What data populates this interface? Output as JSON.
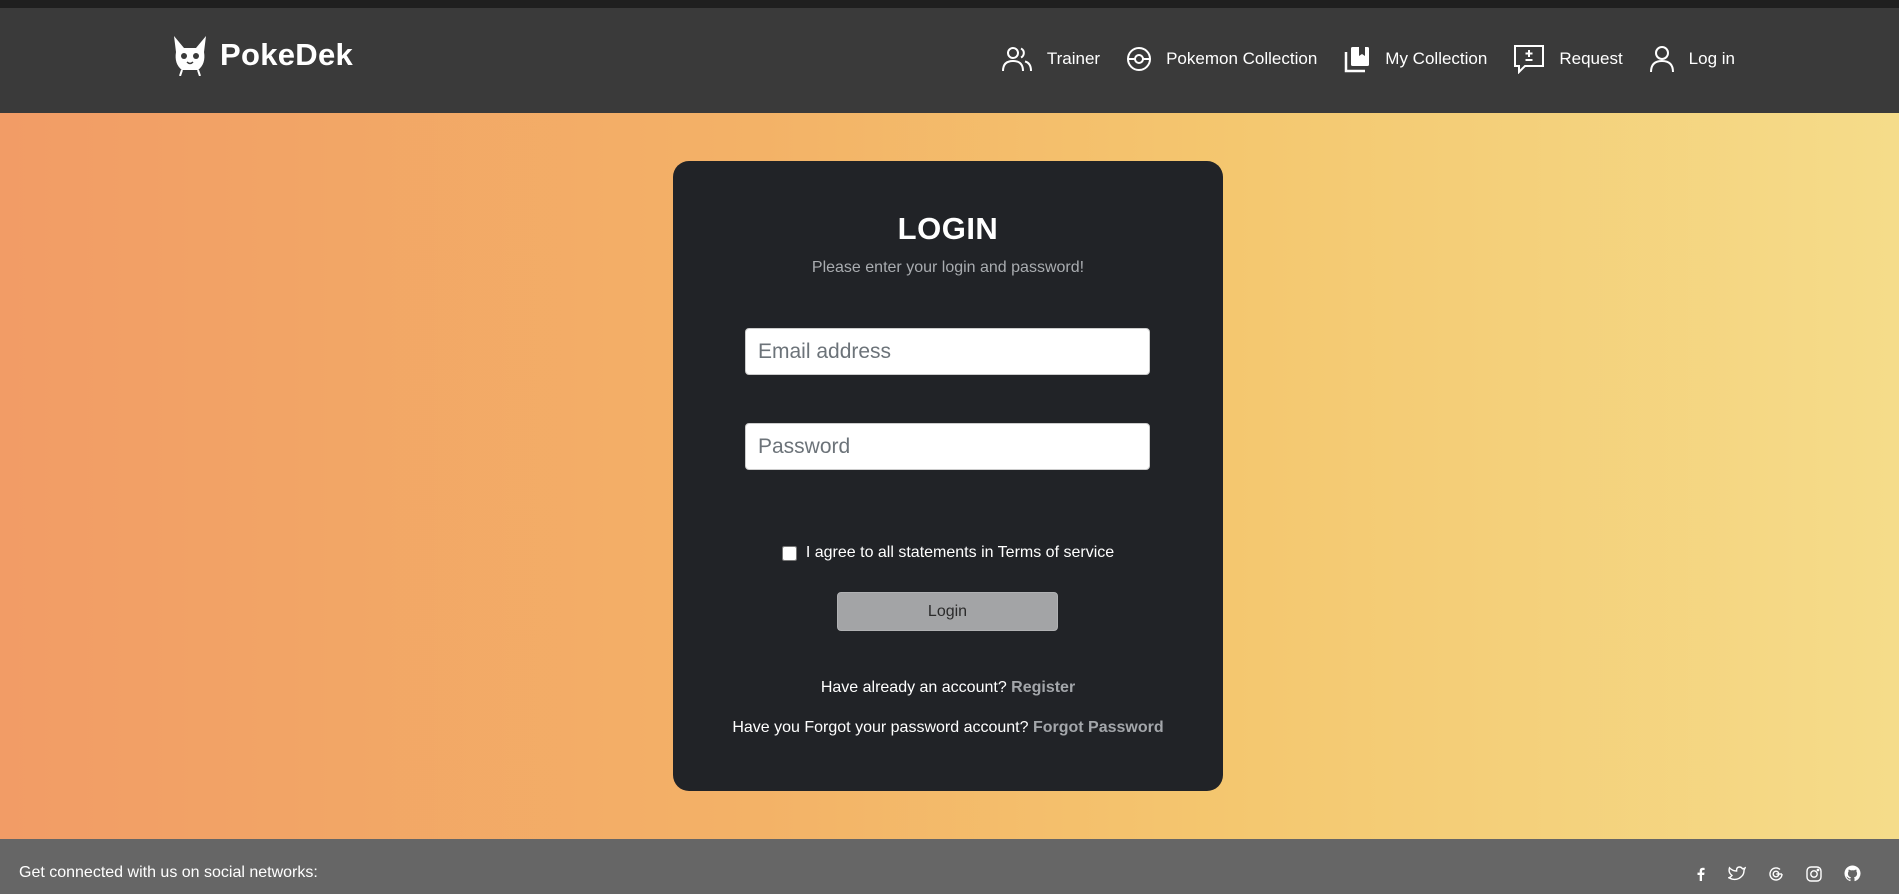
{
  "brand": {
    "name": "PokeDek"
  },
  "nav": {
    "items": [
      {
        "label": "Trainer",
        "icon": "users-icon"
      },
      {
        "label": "Pokemon Collection",
        "icon": "pokeball-icon"
      },
      {
        "label": "My Collection",
        "icon": "collection-icon"
      },
      {
        "label": "Request",
        "icon": "request-icon"
      },
      {
        "label": "Log in",
        "icon": "user-icon"
      }
    ]
  },
  "login": {
    "title": "LOGIN",
    "subtitle": "Please enter your login and password!",
    "email_placeholder": "Email address",
    "password_placeholder": "Password",
    "agree_label": "I agree to all statements in Terms of service",
    "button_label": "Login",
    "register_prompt": "Have already an account? ",
    "register_link": "Register",
    "forgot_prompt": "Have you Forgot your password account? ",
    "forgot_link": "Forgot Password"
  },
  "footer": {
    "text": "Get connected with us on social networks:",
    "socials": [
      "facebook-icon",
      "twitter-icon",
      "google-icon",
      "instagram-icon",
      "github-icon"
    ]
  },
  "colors": {
    "navbar": "#3a3a3a",
    "card": "#212327",
    "footer": "#666666",
    "gradient_start": "#f29c66",
    "gradient_end": "#f5dc8a"
  }
}
